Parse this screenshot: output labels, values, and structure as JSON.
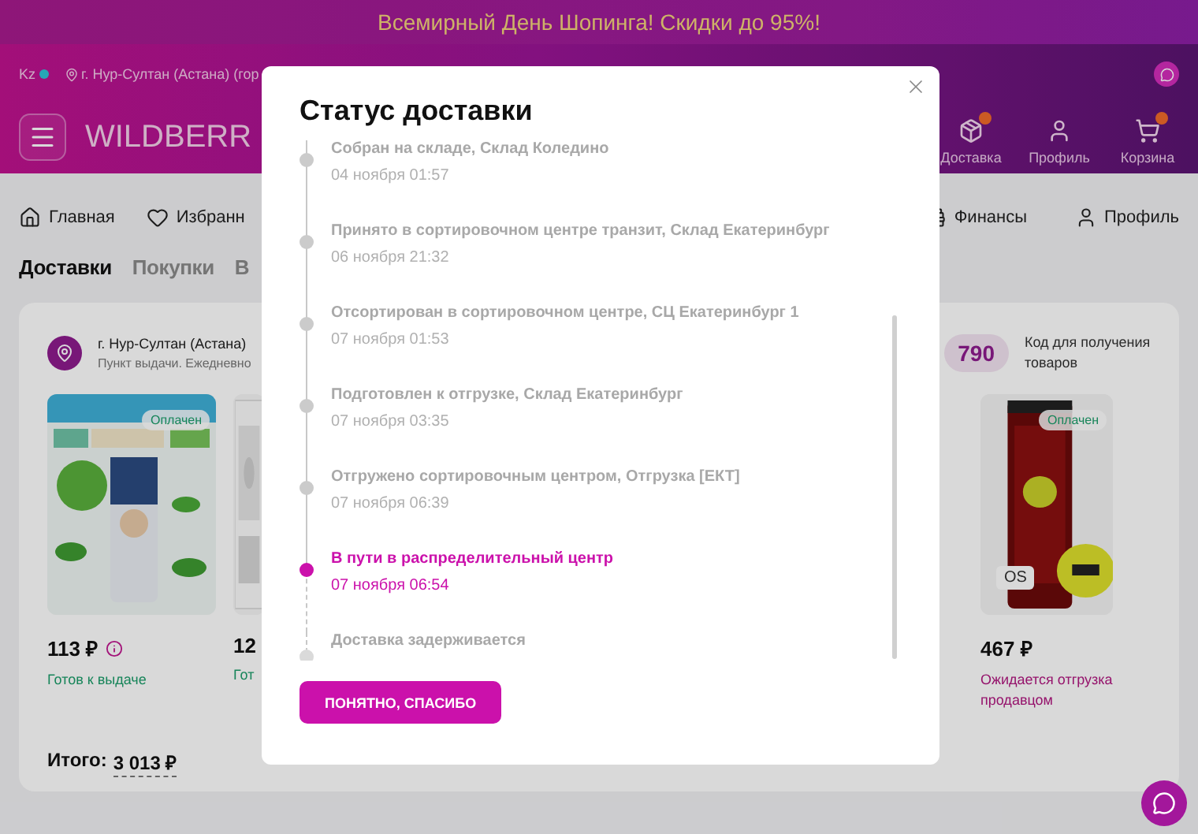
{
  "banner": {
    "text": "Всемирный День Шопинга! Скидки до 95%!"
  },
  "header": {
    "region": "Kz",
    "location": "г. Нур-Султан (Астана) (гор",
    "logo": "WILDBERR",
    "actions": [
      {
        "label": "Доставка",
        "kind": "box",
        "badge": true
      },
      {
        "label": "Профиль",
        "kind": "user",
        "badge": false
      },
      {
        "label": "Корзина",
        "kind": "cart",
        "badge": true
      }
    ]
  },
  "nav": [
    {
      "label": "Главная",
      "kind": "home"
    },
    {
      "label": "Избранн",
      "kind": "heart"
    },
    {
      "label": "Финансы",
      "kind": "wallet"
    },
    {
      "label": "Профиль",
      "kind": "user"
    }
  ],
  "tabs": [
    {
      "label": "Доставки",
      "selected": true
    },
    {
      "label": "Покупки",
      "selected": false
    },
    {
      "label": "В",
      "selected": false
    }
  ],
  "delivery": {
    "address": "г. Нур-Султан (Астана)",
    "hours": "Пункт выдачи. Ежедневно",
    "code": "790",
    "code_label": "Код для получения товаров",
    "products": [
      {
        "badge": "Оплачен",
        "price": "113 ₽",
        "info": true,
        "status": "Готов к выдаче",
        "ready": true
      },
      {
        "price": "12",
        "info": false,
        "status": "Гот",
        "ready": true
      },
      {
        "badge": "Оплачен",
        "size": "OS",
        "price": "467 ₽",
        "info": false,
        "status": "Ожидается отгрузка продавцом",
        "ready": false
      }
    ],
    "total_label": "Итого:",
    "total": "3 013 ₽"
  },
  "modal": {
    "title": "Статус доставки",
    "button": "ПОНЯТНО, СПАСИБО",
    "events": [
      {
        "title": "Собран на складе, Склад Коледино",
        "time": "04 ноября 01:57",
        "done": true,
        "current": false
      },
      {
        "title": "Принято в сортировочном центре транзит, Склад Екатеринбург",
        "time": "06 ноября 21:32",
        "done": true,
        "current": false
      },
      {
        "title": "Отсортирован в сортировочном центре, СЦ Екатеринбург 1",
        "time": "07 ноября 01:53",
        "done": true,
        "current": false
      },
      {
        "title": "Подготовлен к отгрузке, Склад Екатеринбург",
        "time": "07 ноября 03:35",
        "done": true,
        "current": false
      },
      {
        "title": "Отгружено сортировочным центром, Отгрузка [ЕКТ]",
        "time": "07 ноября 06:39",
        "done": true,
        "current": false
      },
      {
        "title": "В пути в распределительный центр",
        "time": "07 ноября 06:54",
        "done": false,
        "current": true
      },
      {
        "title": "Доставка задерживается",
        "done": false,
        "current": false
      }
    ]
  }
}
